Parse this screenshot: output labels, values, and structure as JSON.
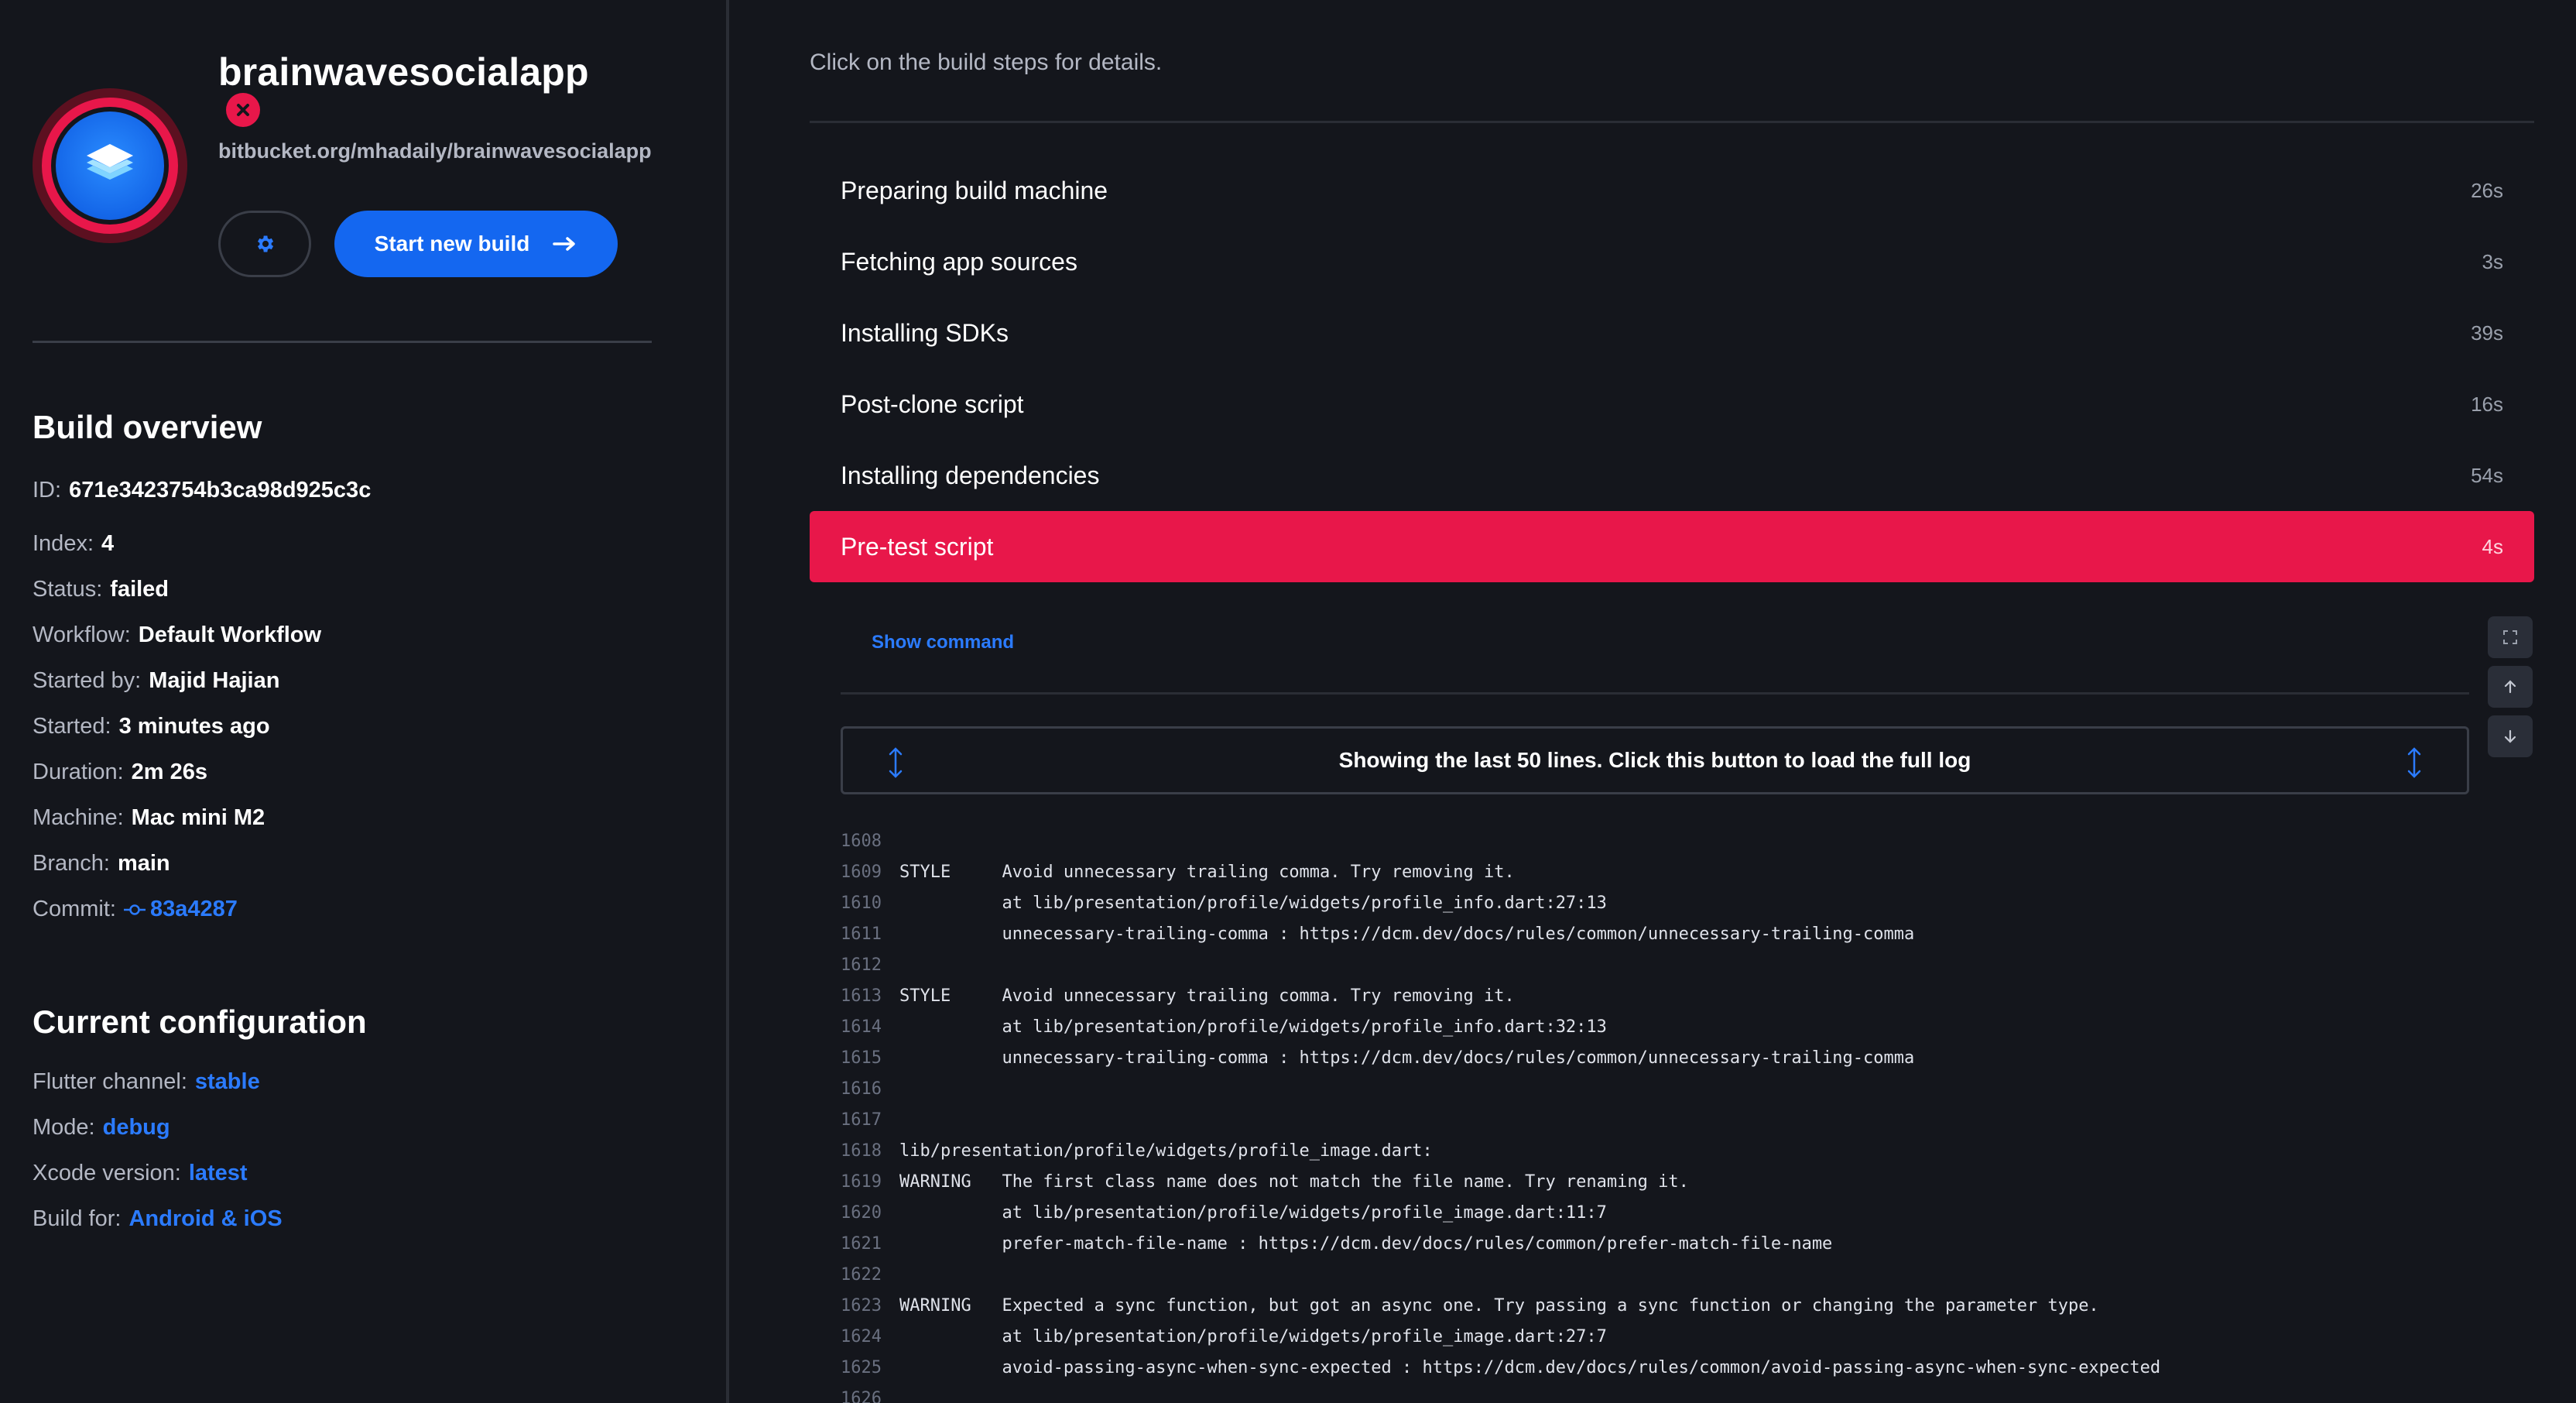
{
  "app": {
    "name": "brainwavesocialapp",
    "repo_url": "bitbucket.org/mhadaily/brainwavesocialapp",
    "start_button_label": "Start new build"
  },
  "overview": {
    "title": "Build overview",
    "rows": [
      {
        "label": "ID:",
        "value": "671e3423754b3ca98d925c3c"
      },
      {
        "label": "Index:",
        "value": "4"
      },
      {
        "label": "Status:",
        "value": "failed"
      },
      {
        "label": "Workflow:",
        "value": "Default Workflow"
      },
      {
        "label": "Started by:",
        "value": "Majid Hajian"
      },
      {
        "label": "Started:",
        "value": "3 minutes ago"
      },
      {
        "label": "Duration:",
        "value": "2m 26s"
      },
      {
        "label": "Machine:",
        "value": "Mac mini M2"
      },
      {
        "label": "Branch:",
        "value": "main"
      },
      {
        "label": "Commit:",
        "value": "83a4287"
      }
    ]
  },
  "configuration": {
    "title": "Current configuration",
    "rows": [
      {
        "label": "Flutter channel:",
        "value": "stable"
      },
      {
        "label": "Mode:",
        "value": "debug"
      },
      {
        "label": "Xcode version:",
        "value": "latest"
      },
      {
        "label": "Build for:",
        "value": "Android & iOS"
      }
    ]
  },
  "main": {
    "hint": "Click on the build steps for details.",
    "steps": [
      {
        "label": "Preparing build machine",
        "duration": "26s"
      },
      {
        "label": "Fetching app sources",
        "duration": "3s"
      },
      {
        "label": "Installing SDKs",
        "duration": "39s"
      },
      {
        "label": "Post-clone script",
        "duration": "16s"
      },
      {
        "label": "Installing dependencies",
        "duration": "54s"
      },
      {
        "label": "Pre-test script",
        "duration": "4s"
      }
    ],
    "active_step_index": 5,
    "show_command_label": "Show command",
    "load_full_log_label": "Showing the last 50 lines. Click this button to load the full log"
  },
  "log": [
    {
      "n": "1608",
      "t": ""
    },
    {
      "n": "1609",
      "t": "STYLE     Avoid unnecessary trailing comma. Try removing it."
    },
    {
      "n": "1610",
      "t": "          at lib/presentation/profile/widgets/profile_info.dart:27:13"
    },
    {
      "n": "1611",
      "t": "          unnecessary-trailing-comma : https://dcm.dev/docs/rules/common/unnecessary-trailing-comma"
    },
    {
      "n": "1612",
      "t": ""
    },
    {
      "n": "1613",
      "t": "STYLE     Avoid unnecessary trailing comma. Try removing it."
    },
    {
      "n": "1614",
      "t": "          at lib/presentation/profile/widgets/profile_info.dart:32:13"
    },
    {
      "n": "1615",
      "t": "          unnecessary-trailing-comma : https://dcm.dev/docs/rules/common/unnecessary-trailing-comma"
    },
    {
      "n": "1616",
      "t": ""
    },
    {
      "n": "1617",
      "t": ""
    },
    {
      "n": "1618",
      "t": "lib/presentation/profile/widgets/profile_image.dart:"
    },
    {
      "n": "1619",
      "t": "WARNING   The first class name does not match the file name. Try renaming it."
    },
    {
      "n": "1620",
      "t": "          at lib/presentation/profile/widgets/profile_image.dart:11:7"
    },
    {
      "n": "1621",
      "t": "          prefer-match-file-name : https://dcm.dev/docs/rules/common/prefer-match-file-name"
    },
    {
      "n": "1622",
      "t": ""
    },
    {
      "n": "1623",
      "t": "WARNING   Expected a sync function, but got an async one. Try passing a sync function or changing the parameter type."
    },
    {
      "n": "1624",
      "t": "          at lib/presentation/profile/widgets/profile_image.dart:27:7"
    },
    {
      "n": "1625",
      "t": "          avoid-passing-async-when-sync-expected : https://dcm.dev/docs/rules/common/avoid-passing-async-when-sync-expected"
    },
    {
      "n": "1626",
      "t": ""
    }
  ],
  "colors": {
    "accent": "#1467f0",
    "failed": "#e8174a",
    "link": "#2b7bff",
    "background": "#14161c"
  },
  "icons": {
    "avatar": "stack-layers-icon",
    "status": "x-circle-icon",
    "settings": "gear-icon",
    "start": "arrow-right-icon",
    "commit": "git-commit-icon",
    "expand": "expand-icon",
    "scroll_up": "arrow-up-icon",
    "scroll_down": "arrow-down-icon",
    "load_full": "vertical-expand-icon"
  }
}
